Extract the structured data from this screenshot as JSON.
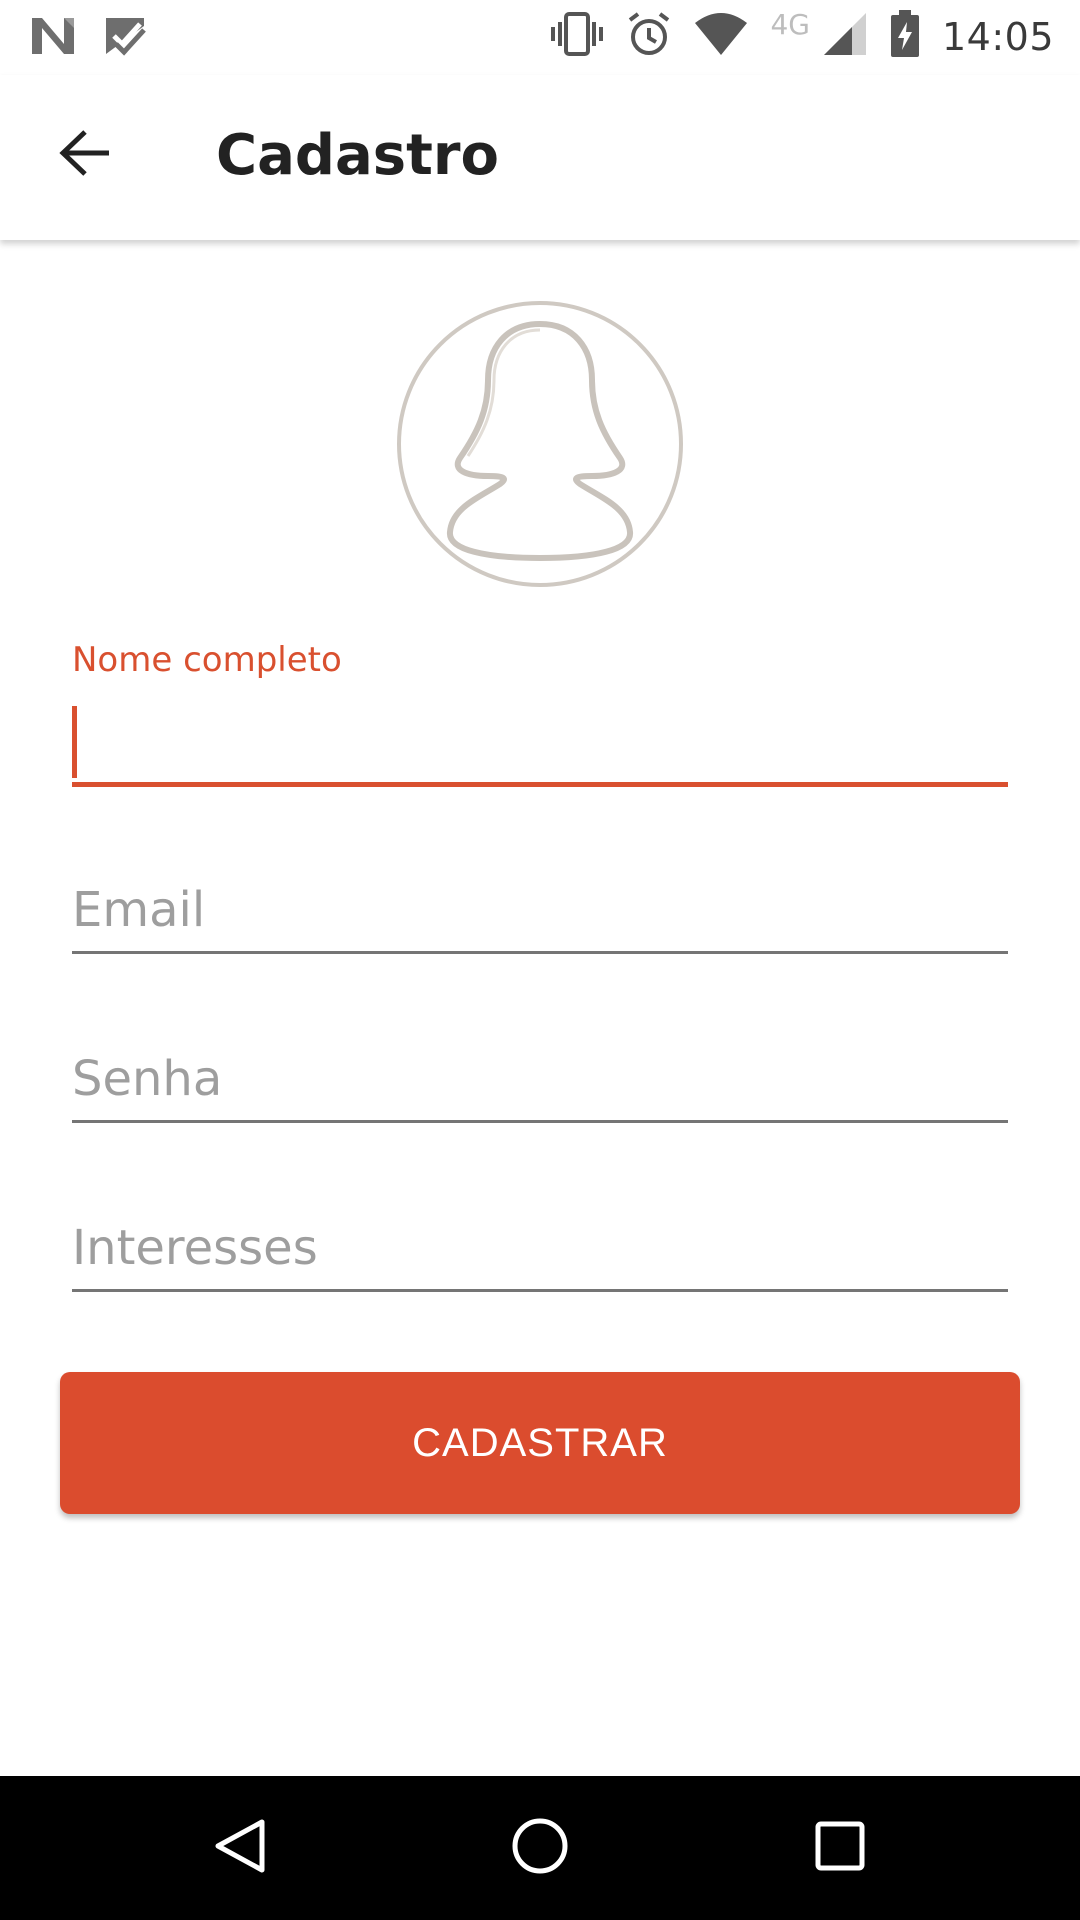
{
  "status_bar": {
    "time": "14:05",
    "network": "4G",
    "icons": [
      "n-notification-icon",
      "check-notification-icon",
      "vibrate-icon",
      "alarm-icon",
      "wifi-icon",
      "signal-icon",
      "battery-charging-icon"
    ]
  },
  "app_bar": {
    "title": "Cadastro",
    "back_icon": "arrow-back-icon"
  },
  "avatar": {
    "icon": "person-placeholder-icon"
  },
  "form": {
    "name": {
      "label": "Nome completo",
      "value": ""
    },
    "email": {
      "placeholder": "Email",
      "value": ""
    },
    "password": {
      "placeholder": "Senha",
      "value": ""
    },
    "interests": {
      "placeholder": "Interesses",
      "value": ""
    }
  },
  "submit": {
    "label": "CADASTRAR"
  },
  "nav_bar": {
    "icons": [
      "nav-back-icon",
      "nav-home-icon",
      "nav-recents-icon"
    ]
  },
  "colors": {
    "accent": "#db4c2e",
    "text_primary": "#222222",
    "placeholder": "#9e9e9e",
    "underline": "#757575"
  }
}
